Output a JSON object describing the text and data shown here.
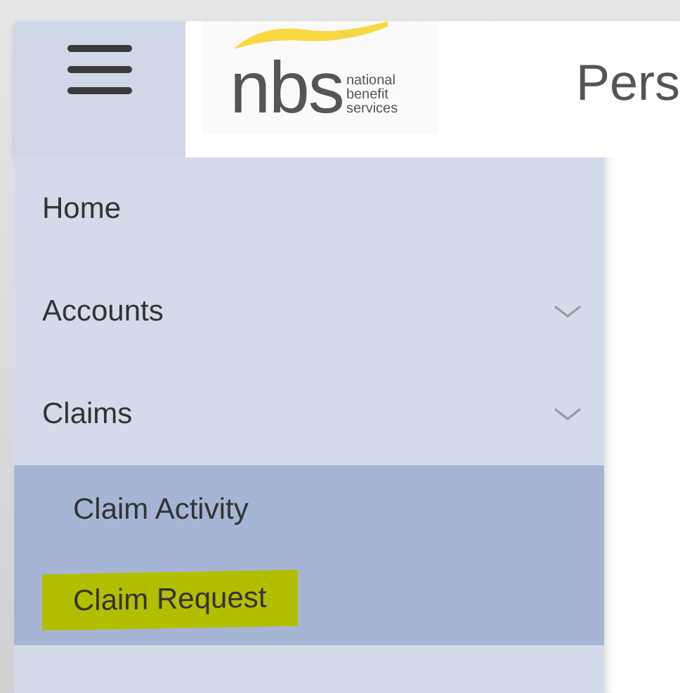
{
  "header": {
    "logo": {
      "mark": "nbs",
      "lines": [
        "national",
        "benefit",
        "services"
      ]
    },
    "title": "Pers"
  },
  "nav": [
    {
      "label": "Home",
      "has_submenu": false
    },
    {
      "label": "Accounts",
      "has_submenu": true
    },
    {
      "label": "Claims",
      "has_submenu": true,
      "children": [
        {
          "label": "Claim Activity",
          "highlighted": false
        },
        {
          "label": "Claim Request",
          "highlighted": true
        }
      ]
    }
  ]
}
